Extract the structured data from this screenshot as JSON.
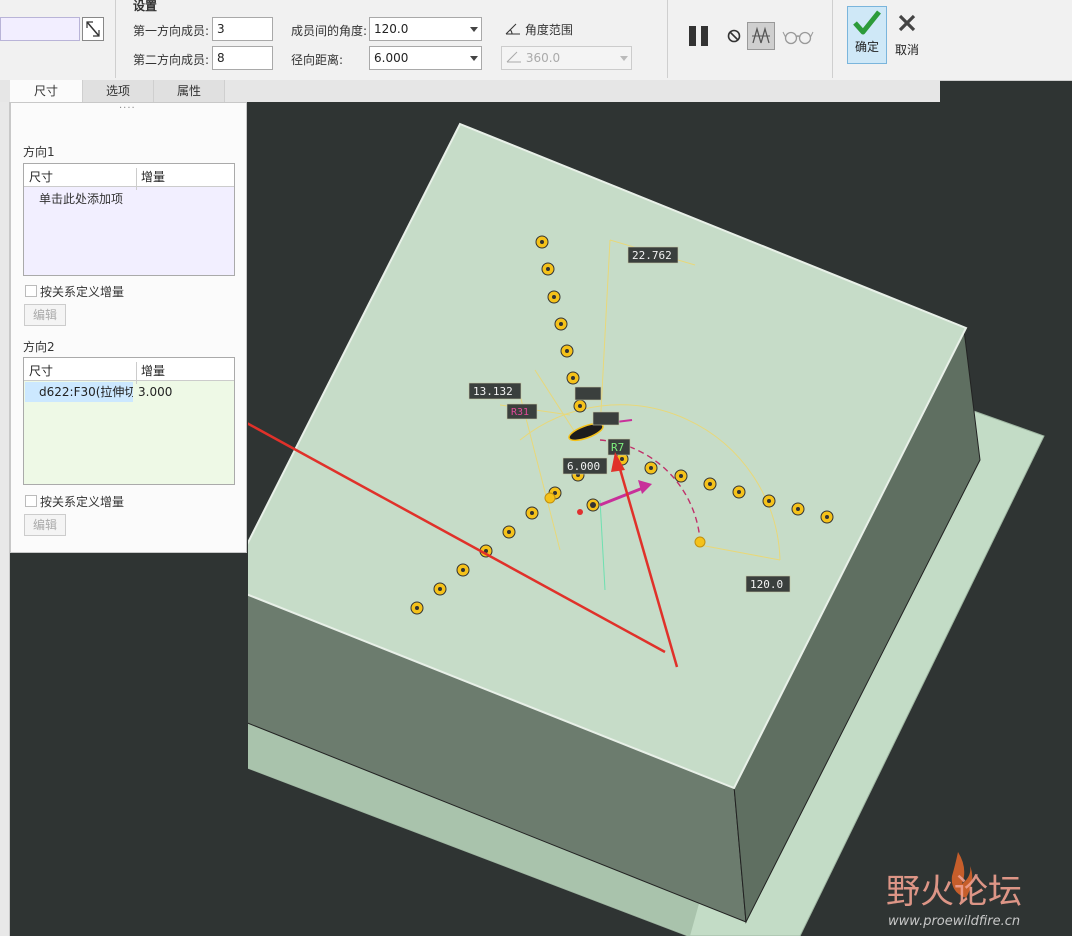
{
  "settings": {
    "title": "设置",
    "members1_label": "第一方向成员:",
    "members1_value": "3",
    "members2_label": "第二方向成员:",
    "members2_value": "8",
    "angle_label": "成员间的角度:",
    "angle_value": "120.0",
    "radial_label": "径向距离:",
    "radial_value": "6.000",
    "angle_range_label": "角度范围",
    "angle_range_value": "360.0"
  },
  "actions": {
    "confirm_label": "确定",
    "cancel_label": "取消"
  },
  "tabs": [
    "尺寸",
    "选项",
    "属性"
  ],
  "panel": {
    "dots": "····",
    "dir1_title": "方向1",
    "dir1_col1": "尺寸",
    "dir1_col2": "增量",
    "dir1_placeholder": "单击此处添加项",
    "dir1_check_label": "按关系定义增量",
    "dir1_edit_label": "编辑",
    "dir2_title": "方向2",
    "dir2_col1": "尺寸",
    "dir2_col2": "增量",
    "dir2_row_dim": "d622:F30(拉伸切",
    "dir2_row_inc": "3.000",
    "dir2_check_label": "按关系定义增量",
    "dir2_edit_label": "编辑"
  },
  "dimensions": {
    "d1": "22.762",
    "d2": "13.132",
    "d3": "6.000",
    "d4": "120.0",
    "r1": "R31",
    "r2": "R7"
  },
  "watermark": {
    "logo_text": "野火论坛",
    "url": "www.proewildfire.cn"
  },
  "colors": {
    "background": "#2f3433",
    "top_face": "#c6dcc8",
    "side_face": "#6a7a6c",
    "pattern_dot": "#f5c21a",
    "arrow": "#e0312a",
    "accent": "#e04a9a",
    "confirm_green": "#2c9b3a"
  }
}
